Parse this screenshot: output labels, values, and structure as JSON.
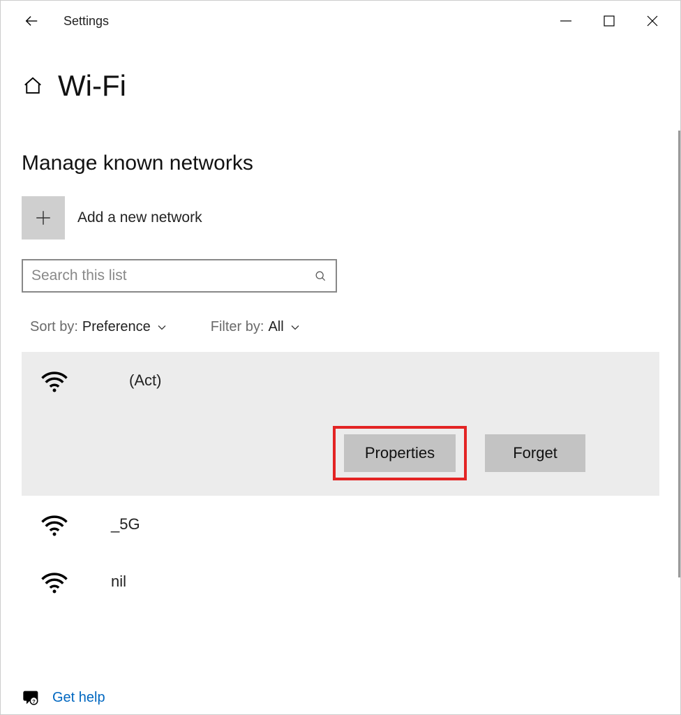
{
  "window": {
    "title": "Settings"
  },
  "page": {
    "title": "Wi-Fi",
    "subheading": "Manage known networks"
  },
  "add_network": {
    "label": "Add a new network"
  },
  "search": {
    "placeholder": "Search this list"
  },
  "sort": {
    "label": "Sort by:",
    "value": "Preference"
  },
  "filter": {
    "label": "Filter by:",
    "value": "All"
  },
  "networks": [
    {
      "name": "(Act)"
    },
    {
      "name": "_5G"
    },
    {
      "name": "nil"
    }
  ],
  "buttons": {
    "properties": "Properties",
    "forget": "Forget"
  },
  "help": {
    "label": "Get help"
  }
}
